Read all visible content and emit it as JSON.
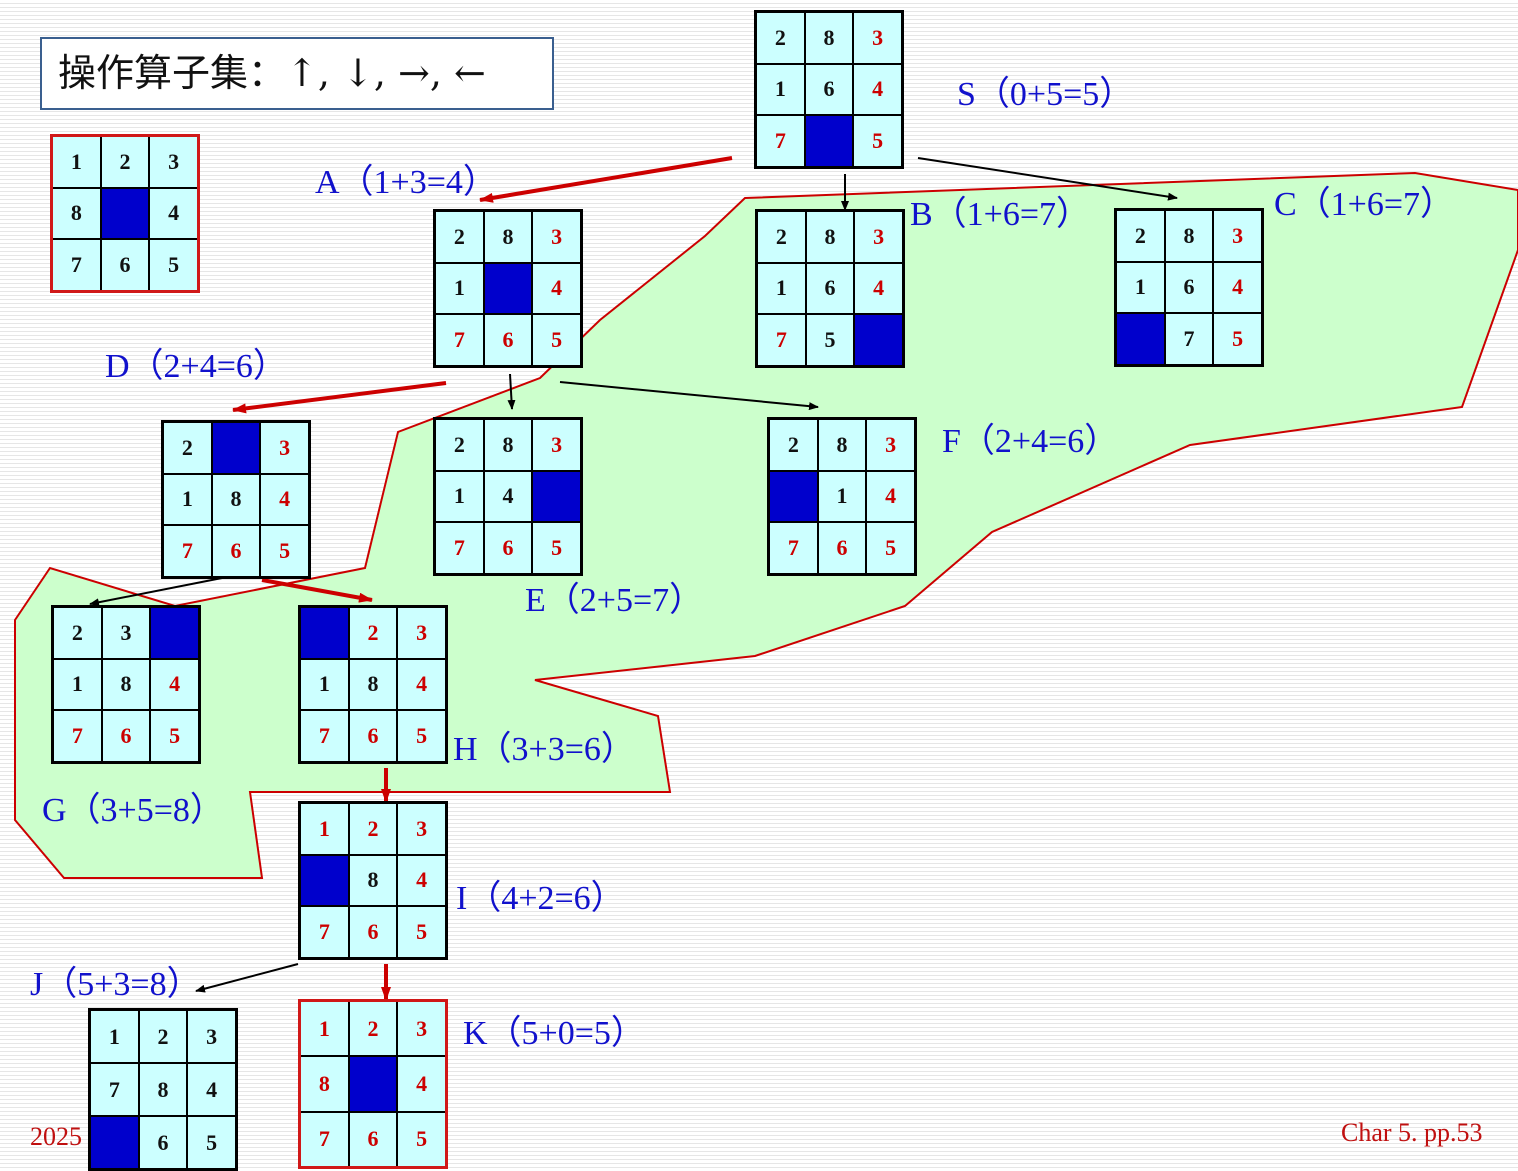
{
  "operator_set": "操作算子集：↑, ↓, →, ←",
  "goal_board": [
    [
      1,
      2,
      3
    ],
    [
      8,
      0,
      4
    ],
    [
      7,
      6,
      5
    ]
  ],
  "nodes": [
    {
      "id": "S",
      "label": "S（0+5=5）",
      "board": [
        [
          2,
          8,
          3
        ],
        [
          1,
          6,
          4
        ],
        [
          7,
          0,
          5
        ]
      ],
      "red": [
        3,
        4,
        7,
        5
      ]
    },
    {
      "id": "A",
      "label": "A（1+3=4）",
      "board": [
        [
          2,
          8,
          3
        ],
        [
          1,
          0,
          4
        ],
        [
          7,
          6,
          5
        ]
      ],
      "red": [
        3,
        4,
        7,
        6,
        5
      ]
    },
    {
      "id": "B",
      "label": "B（1+6=7）",
      "board": [
        [
          2,
          8,
          3
        ],
        [
          1,
          6,
          4
        ],
        [
          7,
          5,
          0
        ]
      ],
      "red": [
        3,
        4,
        7
      ]
    },
    {
      "id": "C",
      "label": "C（1+6=7）",
      "board": [
        [
          2,
          8,
          3
        ],
        [
          1,
          6,
          4
        ],
        [
          0,
          7,
          5
        ]
      ],
      "red": [
        3,
        4,
        5
      ]
    },
    {
      "id": "D",
      "label": "D（2+4=6）",
      "board": [
        [
          2,
          0,
          3
        ],
        [
          1,
          8,
          4
        ],
        [
          7,
          6,
          5
        ]
      ],
      "red": [
        3,
        4,
        7,
        6,
        5
      ]
    },
    {
      "id": "E",
      "label": "E（2+5=7）",
      "board": [
        [
          2,
          8,
          3
        ],
        [
          1,
          4,
          0
        ],
        [
          7,
          6,
          5
        ]
      ],
      "red": [
        3,
        7,
        6,
        5
      ]
    },
    {
      "id": "F",
      "label": "F（2+4=6）",
      "board": [
        [
          2,
          8,
          3
        ],
        [
          0,
          1,
          4
        ],
        [
          7,
          6,
          5
        ]
      ],
      "red": [
        3,
        4,
        7,
        6,
        5
      ]
    },
    {
      "id": "G",
      "label": "G（3+5=8）",
      "board": [
        [
          2,
          3,
          0
        ],
        [
          1,
          8,
          4
        ],
        [
          7,
          6,
          5
        ]
      ],
      "red": [
        4,
        7,
        6,
        5
      ]
    },
    {
      "id": "H",
      "label": "H（3+3=6）",
      "board": [
        [
          0,
          2,
          3
        ],
        [
          1,
          8,
          4
        ],
        [
          7,
          6,
          5
        ]
      ],
      "red": [
        2,
        3,
        4,
        7,
        6,
        5
      ]
    },
    {
      "id": "I",
      "label": "I（4+2=6）",
      "board": [
        [
          1,
          2,
          3
        ],
        [
          0,
          8,
          4
        ],
        [
          7,
          6,
          5
        ]
      ],
      "red": [
        1,
        2,
        3,
        4,
        7,
        6,
        5
      ]
    },
    {
      "id": "J",
      "label": "J（5+3=8）",
      "board": [
        [
          1,
          2,
          3
        ],
        [
          7,
          8,
          4
        ],
        [
          0,
          6,
          5
        ]
      ],
      "red": []
    },
    {
      "id": "K",
      "label": "K（5+0=5）",
      "board": [
        [
          1,
          2,
          3
        ],
        [
          8,
          0,
          4
        ],
        [
          7,
          6,
          5
        ]
      ],
      "red": [
        1,
        2,
        3,
        8,
        4,
        7,
        6,
        5
      ]
    }
  ],
  "edges": [
    {
      "from": "S",
      "to": "A",
      "path": "solution"
    },
    {
      "from": "S",
      "to": "B",
      "path": "other"
    },
    {
      "from": "S",
      "to": "C",
      "path": "other"
    },
    {
      "from": "A",
      "to": "D",
      "path": "solution"
    },
    {
      "from": "A",
      "to": "E",
      "path": "other"
    },
    {
      "from": "A",
      "to": "F",
      "path": "other"
    },
    {
      "from": "D",
      "to": "G",
      "path": "other"
    },
    {
      "from": "D",
      "to": "H",
      "path": "solution"
    },
    {
      "from": "H",
      "to": "I",
      "path": "solution"
    },
    {
      "from": "I",
      "to": "J",
      "path": "other"
    },
    {
      "from": "I",
      "to": "K",
      "path": "solution"
    }
  ],
  "footer": {
    "left": "2025",
    "right": "Char 5. pp.53"
  },
  "colors": {
    "tile_bg": "#ccffff",
    "blank": "#0000cc",
    "label": "#1111cc",
    "closed_region": "#ccffcc",
    "solution_edge": "#cc0000",
    "other_edge": "#000000",
    "goal_border": "#d01818"
  }
}
